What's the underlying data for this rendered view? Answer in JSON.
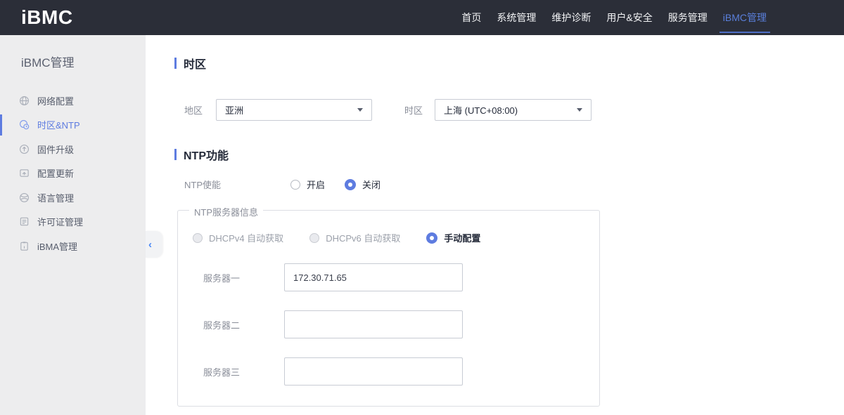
{
  "header": {
    "logo": "iBMC",
    "nav": [
      {
        "label": "首页"
      },
      {
        "label": "系统管理"
      },
      {
        "label": "维护诊断"
      },
      {
        "label": "用户&安全"
      },
      {
        "label": "服务管理"
      },
      {
        "label": "iBMC管理",
        "active": true
      }
    ]
  },
  "sidebar": {
    "title": "iBMC管理",
    "collapse_icon": "‹",
    "items": [
      {
        "label": "网络配置",
        "icon": "network-globe-icon"
      },
      {
        "label": "时区&NTP",
        "icon": "timezone-clock-icon",
        "active": true
      },
      {
        "label": "固件升级",
        "icon": "firmware-upgrade-icon"
      },
      {
        "label": "配置更新",
        "icon": "config-update-icon"
      },
      {
        "label": "语言管理",
        "icon": "language-globe-icon"
      },
      {
        "label": "许可证管理",
        "icon": "license-document-icon"
      },
      {
        "label": "iBMA管理",
        "icon": "ibma-clipboard-icon"
      }
    ]
  },
  "main": {
    "timezone_section": {
      "title": "时区",
      "region_label": "地区",
      "region_value": "亚洲",
      "timezone_label": "时区",
      "timezone_value": "上海 (UTC+08:00)"
    },
    "ntp_section": {
      "title": "NTP功能",
      "enable_label": "NTP使能",
      "enable_on_label": "开启",
      "enable_off_label": "关闭",
      "server_group": {
        "legend": "NTP服务器信息",
        "mode_dhcpv4_label": "DHCPv4 自动获取",
        "mode_dhcpv6_label": "DHCPv6 自动获取",
        "mode_manual_label": "手动配置",
        "servers": [
          {
            "label": "服务器一",
            "value": "172.30.71.65"
          },
          {
            "label": "服务器二",
            "value": ""
          },
          {
            "label": "服务器三",
            "value": ""
          }
        ]
      }
    }
  },
  "colors": {
    "accent_blue": "#5e7ce0",
    "header_bg": "#2b2e38",
    "sidebar_bg": "#ededee",
    "nav_active_blue": "#5a7fdb"
  }
}
